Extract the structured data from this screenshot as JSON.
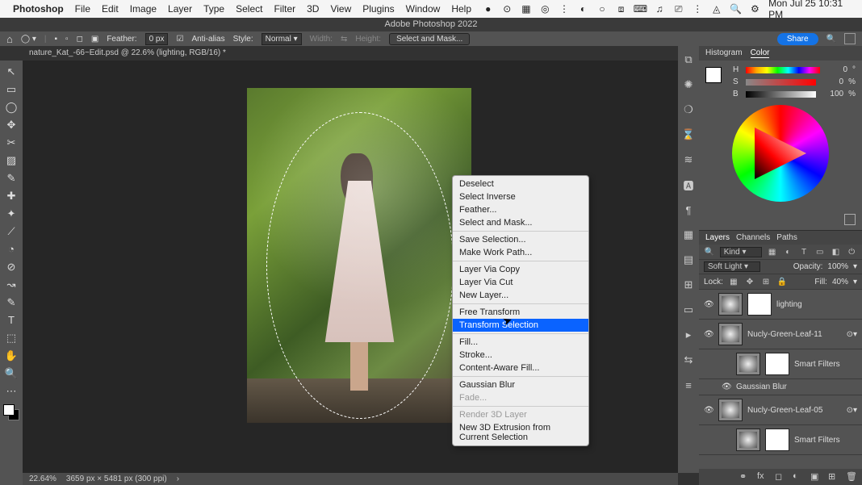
{
  "mac": {
    "app": "Photoshop",
    "menus": [
      "File",
      "Edit",
      "Image",
      "Layer",
      "Type",
      "Select",
      "Filter",
      "3D",
      "View",
      "Plugins",
      "Window",
      "Help"
    ],
    "clock": "Mon Jul 25  10:31 PM",
    "tray": [
      "record",
      "cc",
      "grid",
      "target",
      "dots",
      "cc2",
      "circle",
      "dropbox",
      "keybd",
      "head",
      "monitor",
      "wifi",
      "spotlight",
      "cmd"
    ]
  },
  "app_title": "Adobe Photoshop 2022",
  "options": {
    "feather_label": "Feather:",
    "feather_value": "0 px",
    "anti_alias": "Anti-alias",
    "style_label": "Style:",
    "style_value": "Normal",
    "width_label": "Width:",
    "height_label": "Height:",
    "select_mask": "Select and Mask...",
    "share": "Share"
  },
  "doc_tab": "nature_Kat_-66~Edit.psd @ 22.6% (lighting, RGB/16) *",
  "toolbar": [
    "↖",
    "▭",
    "◯",
    "✥",
    "✂",
    "▨",
    "✎",
    "✚",
    "✦",
    "⟋",
    "◔",
    "⊘",
    "↝",
    "✎",
    "T",
    "⬚",
    "✋",
    "🔍"
  ],
  "right_strip": [
    "⧉",
    "✺",
    "❍",
    "⌛",
    "≋",
    "🅰",
    "¶",
    "▦",
    "▤",
    "⊞",
    "▭",
    "▸",
    "⇆",
    "≡"
  ],
  "ctx": {
    "items": [
      {
        "label": "Deselect",
        "group": 0
      },
      {
        "label": "Select Inverse",
        "group": 0
      },
      {
        "label": "Feather...",
        "group": 0
      },
      {
        "label": "Select and Mask...",
        "group": 0
      },
      {
        "label": "Save Selection...",
        "group": 1
      },
      {
        "label": "Make Work Path...",
        "group": 1
      },
      {
        "label": "Layer Via Copy",
        "group": 2
      },
      {
        "label": "Layer Via Cut",
        "group": 2
      },
      {
        "label": "New Layer...",
        "group": 2
      },
      {
        "label": "Free Transform",
        "group": 3
      },
      {
        "label": "Transform Selection",
        "group": 3,
        "highlight": true
      },
      {
        "label": "Fill...",
        "group": 4
      },
      {
        "label": "Stroke...",
        "group": 4
      },
      {
        "label": "Content-Aware Fill...",
        "group": 4
      },
      {
        "label": "Gaussian Blur",
        "group": 5
      },
      {
        "label": "Fade...",
        "group": 5,
        "disabled": true
      },
      {
        "label": "Render 3D Layer",
        "group": 6,
        "disabled": true
      },
      {
        "label": "New 3D Extrusion from Current Selection",
        "group": 6
      }
    ]
  },
  "panels": {
    "top_tabs": [
      "Histogram",
      "Color"
    ],
    "top_active": "Color",
    "sliders": [
      {
        "lab": "H",
        "val": "0",
        "unit": "°"
      },
      {
        "lab": "S",
        "val": "0",
        "unit": "%"
      },
      {
        "lab": "B",
        "val": "100",
        "unit": "%"
      }
    ],
    "layers_tabs": [
      "Layers",
      "Channels",
      "Paths"
    ],
    "layers_active": "Layers",
    "kind": "Kind",
    "blend": "Soft Light",
    "opacity_label": "Opacity:",
    "opacity_val": "100%",
    "lock_label": "Lock:",
    "fill_label": "Fill:",
    "fill_val": "40%",
    "layers": [
      {
        "eye": true,
        "name": "lighting",
        "mask": true,
        "indent": 0
      },
      {
        "eye": true,
        "name": "Nucly-Green-Leaf-11",
        "mask": false,
        "indent": 0,
        "link": true
      },
      {
        "eye": false,
        "name": "Smart Filters",
        "mask": true,
        "indent": 1
      },
      {
        "eye": true,
        "name": "Gaussian Blur",
        "mask": false,
        "indent": 1,
        "filter": true
      },
      {
        "eye": true,
        "name": "Nucly-Green-Leaf-05",
        "mask": false,
        "indent": 0,
        "link": true
      },
      {
        "eye": false,
        "name": "Smart Filters",
        "mask": true,
        "indent": 1
      }
    ]
  },
  "status": {
    "zoom": "22.64%",
    "dims": "3659 px × 5481 px (300 ppi)"
  }
}
